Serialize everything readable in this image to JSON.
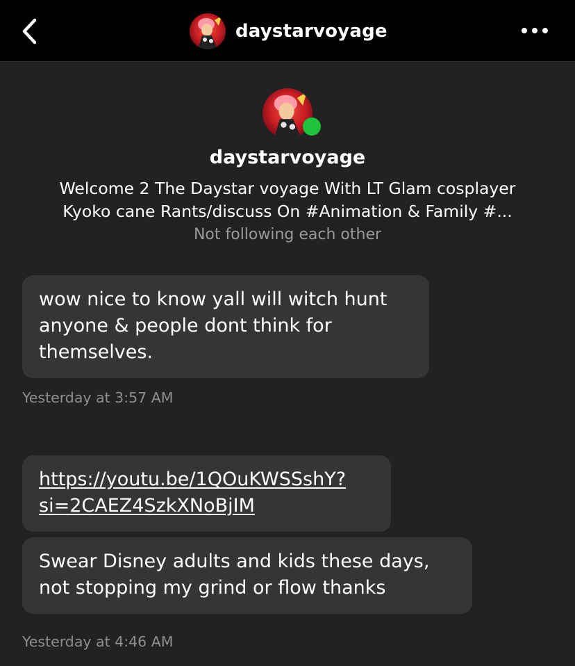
{
  "header": {
    "title": "daystarvoyage",
    "back_icon": "chevron-left-icon",
    "more_icon": "more-horizontal-icon"
  },
  "profile": {
    "name": "daystarvoyage",
    "bio_lines": [
      "Welcome 2 The Daystar voyage With LT Glam cosplayer",
      "Kyoko cane Rants/discuss On #Animation & Family #..."
    ],
    "follow_status": "Not following each other",
    "online_color": "#1ec23b"
  },
  "messages": [
    {
      "lines": [
        "wow nice to know yall will witch hunt",
        "anyone & people dont think for",
        "themselves."
      ]
    },
    {
      "link_lines": [
        "https://youtu.be/1QOuKWSSshY?",
        "si=2CAEZ4SzkXNoBjIM"
      ]
    },
    {
      "lines": [
        "Swear Disney adults and kids these days,",
        "not stopping my grind or flow thanks"
      ]
    }
  ],
  "timestamps": [
    "Yesterday at 3:57 AM",
    "Yesterday at 4:46 AM"
  ],
  "colors": {
    "background": "#222222",
    "header": "#000000",
    "bubble": "#353535",
    "muted_text": "#8e8e8e"
  }
}
